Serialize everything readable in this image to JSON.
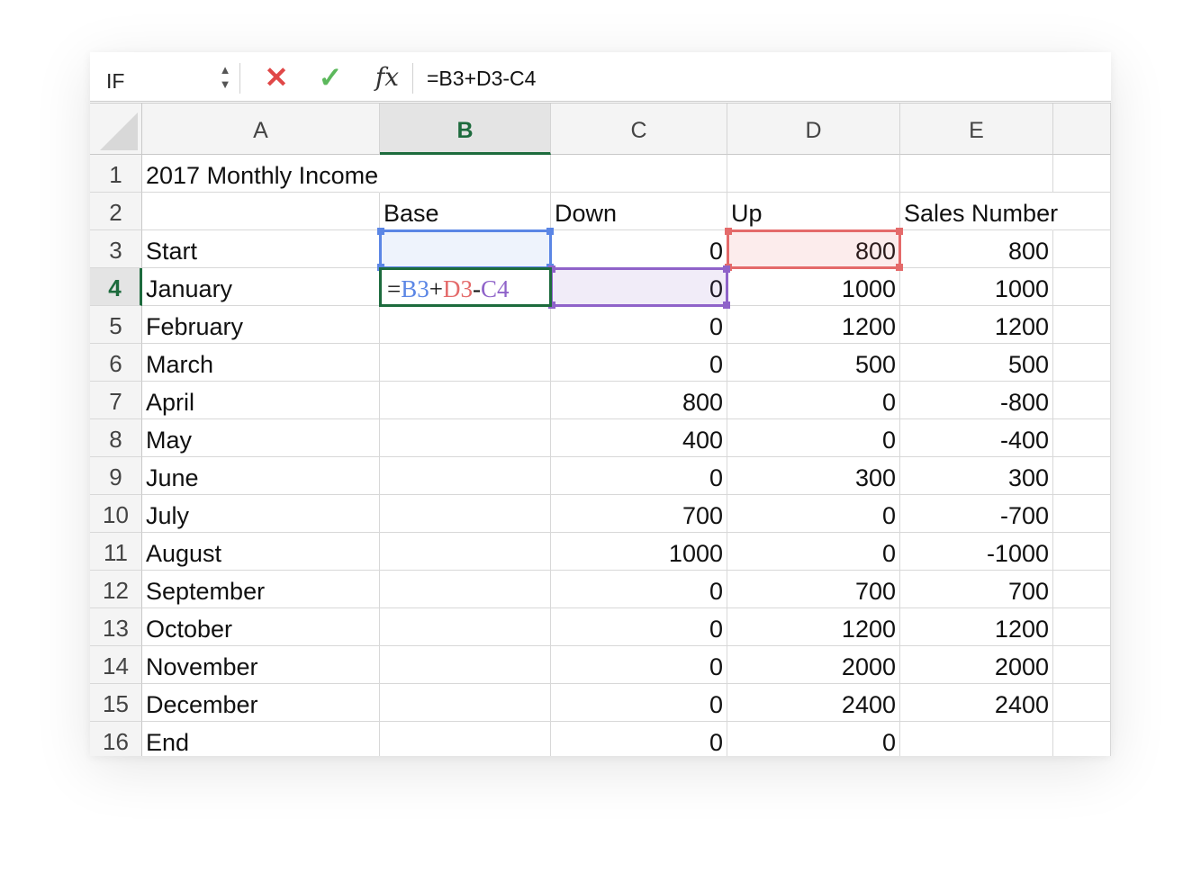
{
  "formula_bar": {
    "name_box": "IF",
    "cancel_icon": "✕",
    "enter_icon": "✓",
    "fx_label": "fx",
    "formula": "=B3+D3-C4"
  },
  "columns": [
    "A",
    "B",
    "C",
    "D",
    "E"
  ],
  "active_cell": {
    "column": "B",
    "row": "4",
    "editing_formula_parts": {
      "eq": "=",
      "ref1": "B3",
      "op1": "+",
      "ref2": "D3",
      "op2": "-",
      "ref3": "C4"
    }
  },
  "reference_colors": {
    "B3": "#5b86e5",
    "D3": "#e46a6a",
    "C4": "#8f63c9",
    "active": "#1d6b3d"
  },
  "rows": [
    {
      "n": "1",
      "A": "2017 Monthly Income",
      "B": "",
      "C": "",
      "D": "",
      "E": ""
    },
    {
      "n": "2",
      "A": "",
      "B": "Base",
      "C": "Down",
      "D": "Up",
      "E": "Sales Number"
    },
    {
      "n": "3",
      "A": "Start",
      "B": "",
      "C": "0",
      "D": "800",
      "E": "800"
    },
    {
      "n": "4",
      "A": "January",
      "B": "",
      "C": "0",
      "D": "1000",
      "E": "1000"
    },
    {
      "n": "5",
      "A": "February",
      "B": "",
      "C": "0",
      "D": "1200",
      "E": "1200"
    },
    {
      "n": "6",
      "A": "March",
      "B": "",
      "C": "0",
      "D": "500",
      "E": "500"
    },
    {
      "n": "7",
      "A": "April",
      "B": "",
      "C": "800",
      "D": "0",
      "E": "-800"
    },
    {
      "n": "8",
      "A": "May",
      "B": "",
      "C": "400",
      "D": "0",
      "E": "-400"
    },
    {
      "n": "9",
      "A": "June",
      "B": "",
      "C": "0",
      "D": "300",
      "E": "300"
    },
    {
      "n": "10",
      "A": "July",
      "B": "",
      "C": "700",
      "D": "0",
      "E": "-700"
    },
    {
      "n": "11",
      "A": "August",
      "B": "",
      "C": "1000",
      "D": "0",
      "E": "-1000"
    },
    {
      "n": "12",
      "A": "September",
      "B": "",
      "C": "0",
      "D": "700",
      "E": "700"
    },
    {
      "n": "13",
      "A": "October",
      "B": "",
      "C": "0",
      "D": "1200",
      "E": "1200"
    },
    {
      "n": "14",
      "A": "November",
      "B": "",
      "C": "0",
      "D": "2000",
      "E": "2000"
    },
    {
      "n": "15",
      "A": "December",
      "B": "",
      "C": "0",
      "D": "2400",
      "E": "2400"
    },
    {
      "n": "16",
      "A": "End",
      "B": "",
      "C": "0",
      "D": "0",
      "E": ""
    }
  ]
}
